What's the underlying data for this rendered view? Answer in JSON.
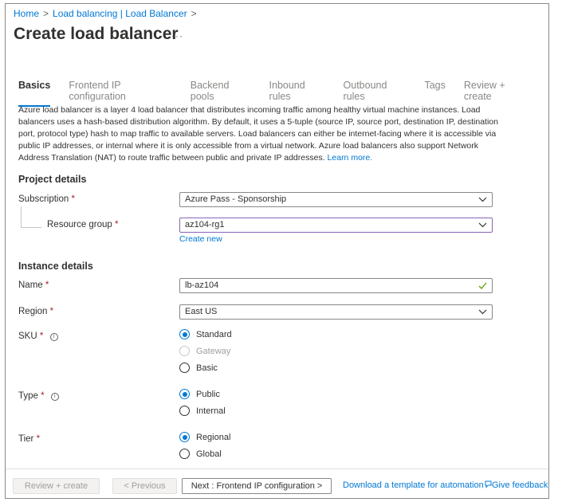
{
  "breadcrumb": {
    "home": "Home",
    "parent": "Load balancing | Load Balancer",
    "sep": ">"
  },
  "page": {
    "title": "Create load balancer",
    "more": "···"
  },
  "tabs": [
    {
      "label": "Basics",
      "active": true
    },
    {
      "label": "Frontend IP configuration",
      "active": false
    },
    {
      "label": "Backend pools",
      "active": false
    },
    {
      "label": "Inbound rules",
      "active": false
    },
    {
      "label": "Outbound rules",
      "active": false
    },
    {
      "label": "Tags",
      "active": false
    },
    {
      "label": "Review + create",
      "active": false
    }
  ],
  "intro": {
    "text": "Azure load balancer is a layer 4 load balancer that distributes incoming traffic among healthy virtual machine instances. Load balancers uses a hash-based distribution algorithm. By default, it uses a 5-tuple (source IP, source port, destination IP, destination port, protocol type) hash to map traffic to available servers. Load balancers can either be internet-facing where it is accessible via public IP addresses, or internal where it is only accessible from a virtual network. Azure load balancers also support Network Address Translation (NAT) to route traffic between public and private IP addresses.",
    "learn_more": "Learn more."
  },
  "project": {
    "title": "Project details",
    "subscription_label": "Subscription",
    "subscription_value": "Azure Pass - Sponsorship",
    "resource_group_label": "Resource group",
    "resource_group_value": "az104-rg1",
    "create_new": "Create new"
  },
  "instance": {
    "title": "Instance details",
    "name_label": "Name",
    "name_value": "lb-az104",
    "region_label": "Region",
    "region_value": "East US",
    "sku_label": "SKU",
    "sku_options": [
      {
        "label": "Standard",
        "checked": true,
        "disabled": false
      },
      {
        "label": "Gateway",
        "checked": false,
        "disabled": true
      },
      {
        "label": "Basic",
        "checked": false,
        "disabled": false
      }
    ],
    "type_label": "Type",
    "type_options": [
      {
        "label": "Public",
        "checked": true
      },
      {
        "label": "Internal",
        "checked": false
      }
    ],
    "tier_label": "Tier",
    "tier_options": [
      {
        "label": "Regional",
        "checked": true
      },
      {
        "label": "Global",
        "checked": false
      }
    ]
  },
  "required_marker": "*",
  "info_glyph": "i",
  "footer": {
    "review_create": "Review + create",
    "previous": "< Previous",
    "next": "Next : Frontend IP configuration >",
    "download_template": "Download a template for automation",
    "feedback": "Give feedback"
  },
  "colors": {
    "accent": "#0078d4",
    "required": "#a4262c",
    "valid_check": "#57a300"
  }
}
